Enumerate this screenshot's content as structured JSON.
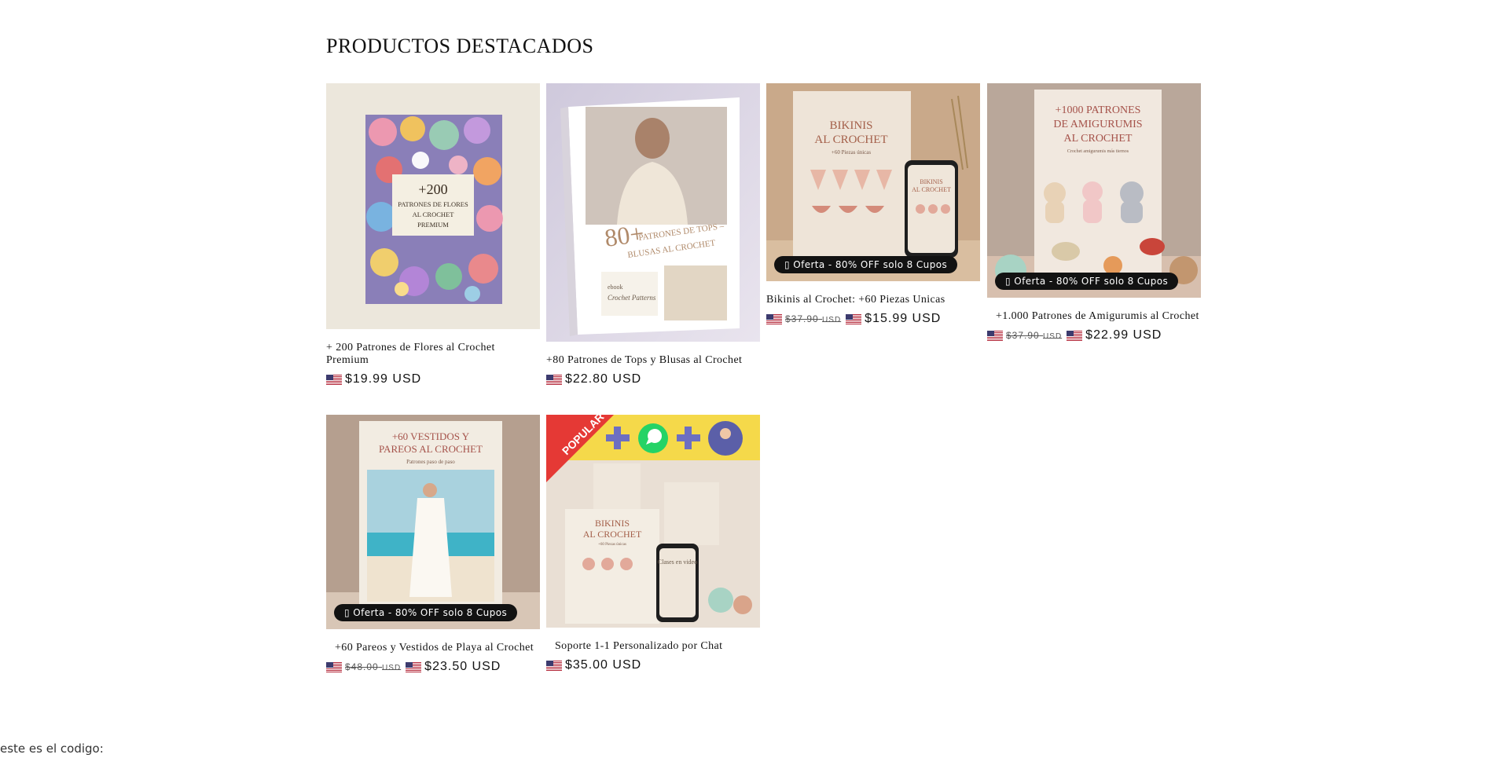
{
  "section": {
    "title": "PRODUCTOS DESTACADOS"
  },
  "products": [
    {
      "title": "+ 200 Patrones de Flores al Crochet Premium",
      "price": "$19.99 USD",
      "cover": {
        "line1": "+200",
        "line2": "PATRONES DE FLORES",
        "line3": "AL CROCHET",
        "line4": "PREMIUM"
      }
    },
    {
      "title": "+80 Patrones de Tops y Blusas al Crochet",
      "price": "$22.80 USD",
      "cover": {
        "big": "80+",
        "line1": "PATRONES DE TOPS –",
        "line2": "BLUSAS AL CROCHET",
        "tag1": "ebook",
        "tag2": "Crochet Patterns"
      }
    },
    {
      "title": "Bikinis al Crochet: +60 Piezas Unicas",
      "old_price": "$37.90",
      "old_currency": "USD",
      "price": "$15.99 USD",
      "badge": "Oferta - 80% OFF solo 8 Cupos",
      "cover": {
        "line1": "BIKINIS",
        "line2": "AL CROCHET",
        "line3": "+60 Piezas únicas",
        "phone1": "BIKINIS",
        "phone2": "AL CROCHET"
      }
    },
    {
      "title": "+1.000 Patrones de Amigurumis al Crochet",
      "old_price": "$37.90",
      "old_currency": "USD",
      "price": "$22.99 USD",
      "badge": "Oferta - 80% OFF solo 8 Cupos",
      "cover": {
        "line1": "+1000 PATRONES",
        "line2": "DE AMIGURUMIS",
        "line3": "AL CROCHET",
        "line4": "Crochet amigurumis más tiernos"
      }
    },
    {
      "title": "+60 Pareos y Vestidos de Playa al Crochet",
      "old_price": "$48.00",
      "old_currency": "USD",
      "price": "$23.50 USD",
      "badge": "Oferta - 80% OFF solo 8 Cupos",
      "cover": {
        "line1": "+60 VESTIDOS Y",
        "line2": "PAREOS AL CROCHET",
        "line3": "Patrones paso de paso"
      }
    },
    {
      "title": "Soporte 1-1 Personalizado por Chat",
      "price": "$35.00 USD",
      "cover": {
        "ribbon": "POPULAR",
        "book1": "BIKINIS",
        "book2": "AL CROCHET",
        "book3": "+60 Piezas únicas",
        "phone": "Clases en video"
      }
    }
  ],
  "colors": {
    "badge_bg": "#121212",
    "text": "#121212",
    "accent_yellow": "#f5d94a",
    "ribbon_red": "#e53935"
  },
  "icons": {
    "flag": "us-flag-icon",
    "badge_icon": "tag-icon"
  },
  "footer": {
    "text": "este es el codigo:"
  }
}
